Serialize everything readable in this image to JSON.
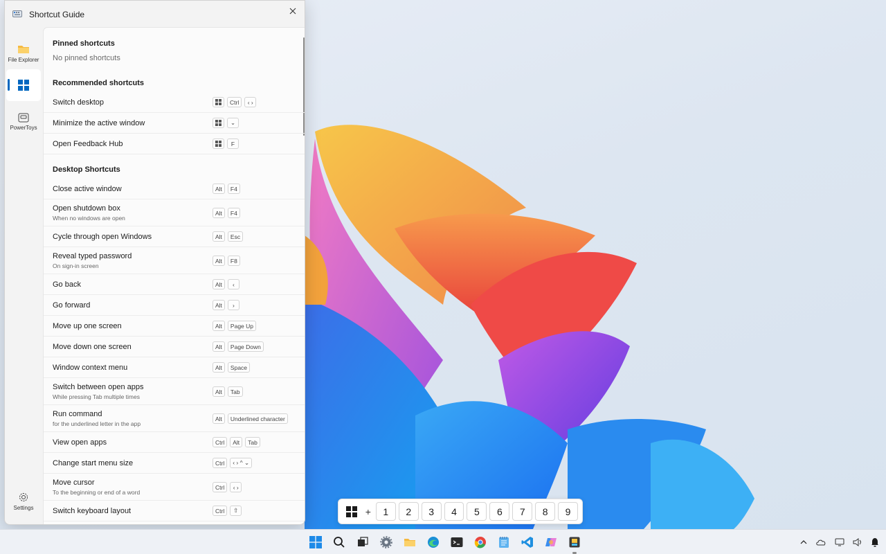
{
  "window": {
    "title": "Shortcut Guide"
  },
  "nav": [
    {
      "label": "File Explorer",
      "icon": "folder-icon"
    },
    {
      "label": "",
      "icon": "windows-logo-icon",
      "selected": true
    },
    {
      "label": "PowerToys",
      "icon": "powertoys-icon"
    },
    {
      "label": "Settings",
      "icon": "gear-icon"
    }
  ],
  "pinned": {
    "title": "Pinned shortcuts",
    "empty": "No pinned shortcuts"
  },
  "recommended": {
    "title": "Recommended shortcuts",
    "items": [
      {
        "name": "Switch desktop",
        "keys": [
          "win",
          "Ctrl",
          "‹ ›"
        ]
      },
      {
        "name": "Minimize the active window",
        "keys": [
          "win",
          "⌄"
        ]
      },
      {
        "name": "Open Feedback Hub",
        "keys": [
          "win",
          "F"
        ]
      }
    ]
  },
  "desktop": {
    "title": "Desktop Shortcuts",
    "items": [
      {
        "name": "Close active window",
        "sub": "",
        "keys": [
          "Alt",
          "F4"
        ]
      },
      {
        "name": "Open shutdown box",
        "sub": "When no windows are open",
        "keys": [
          "Alt",
          "F4"
        ]
      },
      {
        "name": "Cycle through open Windows",
        "sub": "",
        "keys": [
          "Alt",
          "Esc"
        ]
      },
      {
        "name": "Reveal typed password",
        "sub": "On sign-in screen",
        "keys": [
          "Alt",
          "F8"
        ]
      },
      {
        "name": "Go back",
        "sub": "",
        "keys": [
          "Alt",
          "‹"
        ]
      },
      {
        "name": "Go forward",
        "sub": "",
        "keys": [
          "Alt",
          "›"
        ]
      },
      {
        "name": "Move up one screen",
        "sub": "",
        "keys": [
          "Alt",
          "Page Up"
        ]
      },
      {
        "name": "Move down one screen",
        "sub": "",
        "keys": [
          "Alt",
          "Page Down"
        ]
      },
      {
        "name": "Window context menu",
        "sub": "",
        "keys": [
          "Alt",
          "Space"
        ]
      },
      {
        "name": "Switch between open apps",
        "sub": "While pressing Tab multiple times",
        "keys": [
          "Alt",
          "Tab"
        ]
      },
      {
        "name": "Run command",
        "sub": "for the underlined letter in the app",
        "keys": [
          "Alt",
          "Underlined character"
        ]
      },
      {
        "name": "View open apps",
        "sub": "",
        "keys": [
          "Ctrl",
          "Alt",
          "Tab"
        ]
      },
      {
        "name": "Change start menu size",
        "sub": "",
        "keys": [
          "Ctrl",
          "‹ › ^ ⌄"
        ]
      },
      {
        "name": "Move cursor",
        "sub": "To the beginning or end of a word",
        "keys": [
          "Ctrl",
          "‹ ›"
        ]
      },
      {
        "name": "Switch keyboard layout",
        "sub": "",
        "keys": [
          "Ctrl",
          "⇧"
        ]
      }
    ]
  },
  "workspaces": {
    "plus": "+",
    "numbers": [
      "1",
      "2",
      "3",
      "4",
      "5",
      "6",
      "7",
      "8",
      "9"
    ]
  },
  "taskbar": {
    "apps": [
      "start-icon",
      "search-icon",
      "task-view-icon",
      "settings-icon",
      "file-explorer-icon",
      "edge-icon",
      "terminal-icon",
      "chrome-icon",
      "notepad-icon",
      "vscode-icon",
      "copilot-icon",
      "powertoys-icon"
    ]
  },
  "tray": [
    "chevron-up-icon",
    "onedrive-icon",
    "network-icon",
    "volume-icon",
    "notification-icon"
  ]
}
